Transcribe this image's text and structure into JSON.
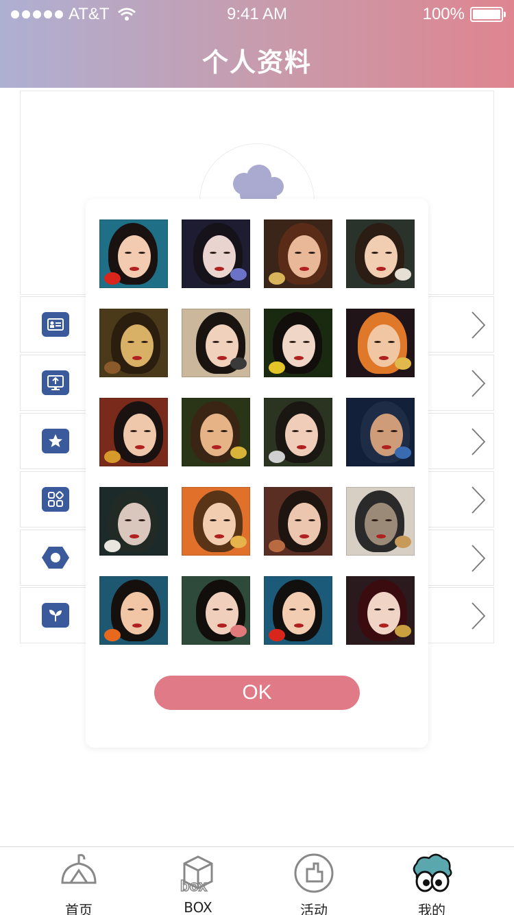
{
  "status_bar": {
    "carrier": "AT&T",
    "time": "9:41 AM",
    "battery": "100%"
  },
  "header": {
    "title": "个人资料"
  },
  "avatar_picker": {
    "ok_label": "OK",
    "tiles": [
      {
        "bg": "#1f6f86",
        "skin": "#f2cbb0",
        "hair": "#1a1210",
        "accent": "#d8261c"
      },
      {
        "bg": "#1d1c30",
        "skin": "#e9d4d0",
        "hair": "#15121a",
        "accent": "#6d72c9"
      },
      {
        "bg": "#3b2418",
        "skin": "#e9b898",
        "hair": "#5a2c18",
        "accent": "#d9b45a"
      },
      {
        "bg": "#2a332b",
        "skin": "#f1cdb1",
        "hair": "#2b1c14",
        "accent": "#e6e0d4"
      },
      {
        "bg": "#4a3a1a",
        "skin": "#d8b066",
        "hair": "#2b1e0e",
        "accent": "#8a5a2a"
      },
      {
        "bg": "#cbb79c",
        "skin": "#f0d2bc",
        "hair": "#1a1410",
        "accent": "#3a3a3a"
      },
      {
        "bg": "#1a2a10",
        "skin": "#f0d6c6",
        "hair": "#120e0c",
        "accent": "#e3c52a"
      },
      {
        "bg": "#201418",
        "skin": "#f1c6a2",
        "hair": "#e0782a",
        "accent": "#e0b94a"
      },
      {
        "bg": "#7a2a1a",
        "skin": "#efc7aa",
        "hair": "#1a1210",
        "accent": "#d59a2a"
      },
      {
        "bg": "#2a3416",
        "skin": "#e6b386",
        "hair": "#3a2414",
        "accent": "#d9b23a"
      },
      {
        "bg": "#2a3420",
        "skin": "#efcdb8",
        "hair": "#1a1612",
        "accent": "#d0d0d0"
      },
      {
        "bg": "#13203a",
        "skin": "#cf9c7a",
        "hair": "#1e2c46",
        "accent": "#3a6ab0"
      },
      {
        "bg": "#1c2a2a",
        "skin": "#d9c6bc",
        "hair": "#222a26",
        "accent": "#e9e6e0"
      },
      {
        "bg": "#e0702a",
        "skin": "#f2cdb0",
        "hair": "#5a3416",
        "accent": "#e6b44a"
      },
      {
        "bg": "#5a2e22",
        "skin": "#ecc6ae",
        "hair": "#1e1410",
        "accent": "#b86a40"
      },
      {
        "bg": "#d8cfc4",
        "skin": "#9b8a78",
        "hair": "#2a2a2a",
        "accent": "#c89a5a"
      },
      {
        "bg": "#1d5870",
        "skin": "#f0c6a6",
        "hair": "#15100e",
        "accent": "#e8681e"
      },
      {
        "bg": "#2e4a3a",
        "skin": "#f0d0bc",
        "hair": "#120e0c",
        "accent": "#e07a7a"
      },
      {
        "bg": "#1c5a7a",
        "skin": "#f2cdb2",
        "hair": "#12100e",
        "accent": "#d8261c"
      },
      {
        "bg": "#2a1a1e",
        "skin": "#f0d4c6",
        "hair": "#3a0c10",
        "accent": "#c8a040"
      }
    ]
  },
  "menu_rows": [
    {
      "icon": "id-card-icon"
    },
    {
      "icon": "upload-monitor-icon"
    },
    {
      "icon": "star-icon"
    },
    {
      "icon": "apps-grid-icon"
    },
    {
      "icon": "hexagon-icon"
    },
    {
      "icon": "sprout-icon"
    }
  ],
  "tabbar": {
    "tabs": [
      {
        "label": "首页",
        "icon": "house-icon"
      },
      {
        "label": "BOX",
        "icon": "box-icon"
      },
      {
        "label": "活动",
        "icon": "activity-icon"
      },
      {
        "label": "我的",
        "icon": "cloud-eyes-icon"
      }
    ]
  },
  "colors": {
    "accent": "#e07a86",
    "icon_blue": "#3a5a9b",
    "header_start": "#aeb0d3",
    "header_end": "#df8590"
  }
}
